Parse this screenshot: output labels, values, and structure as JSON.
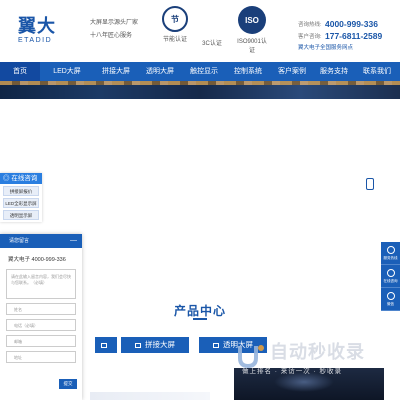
{
  "header": {
    "logo_main": "翼大",
    "logo_sub": "ETADID",
    "slogan_line1": "大屏显示源头厂家",
    "slogan_line2": "十八年匠心服务",
    "certs": [
      {
        "label": "节能认证",
        "badge": "节"
      },
      {
        "label": "3C认证"
      },
      {
        "label": "ISO9001认证",
        "badge": "ISO"
      }
    ],
    "hotline_label": "咨询热线:",
    "hotline": "4000-999-336",
    "service_label": "客户咨询:",
    "service_phone": "177-6811-2589",
    "company_note": "翼大电子全国服务网点"
  },
  "nav": {
    "items": [
      {
        "label": "首页",
        "active": true
      },
      {
        "label": "LED大屏"
      },
      {
        "label": "拼接大屏"
      },
      {
        "label": "透明大屏"
      },
      {
        "label": "触控显示"
      },
      {
        "label": "控制系统"
      },
      {
        "label": "客户案例"
      },
      {
        "label": "服务支持"
      },
      {
        "label": "联系我们"
      }
    ]
  },
  "left_float": {
    "title": "在线咨询",
    "items": [
      "拼接屏报价",
      "LED全彩显示屏",
      "透明显示屏"
    ]
  },
  "right_float": {
    "items": [
      "服务热线",
      "在线咨询",
      "微信"
    ]
  },
  "chat": {
    "header": "请您留言",
    "minimize": "—",
    "company_line": "翼大电子 4000-999-336",
    "message_placeholder": "请在此输入留言内容，我们会尽快与您联系。（必填）",
    "fields": [
      {
        "placeholder": "姓名"
      },
      {
        "placeholder": "电话（必填）"
      },
      {
        "placeholder": "邮箱"
      },
      {
        "placeholder": "地址"
      }
    ],
    "submit": "提交"
  },
  "products": {
    "title": "产品中心",
    "tabs": [
      "",
      "拼接大屏",
      "透明大屏"
    ]
  },
  "watermark": {
    "text": "自动秒收录",
    "sub": "做上排名 · 来访一次 · 秒收录"
  },
  "colors": {
    "primary": "#1a5fb8",
    "primary_dark": "#1249a0",
    "accent_text": "#1a56a8"
  }
}
